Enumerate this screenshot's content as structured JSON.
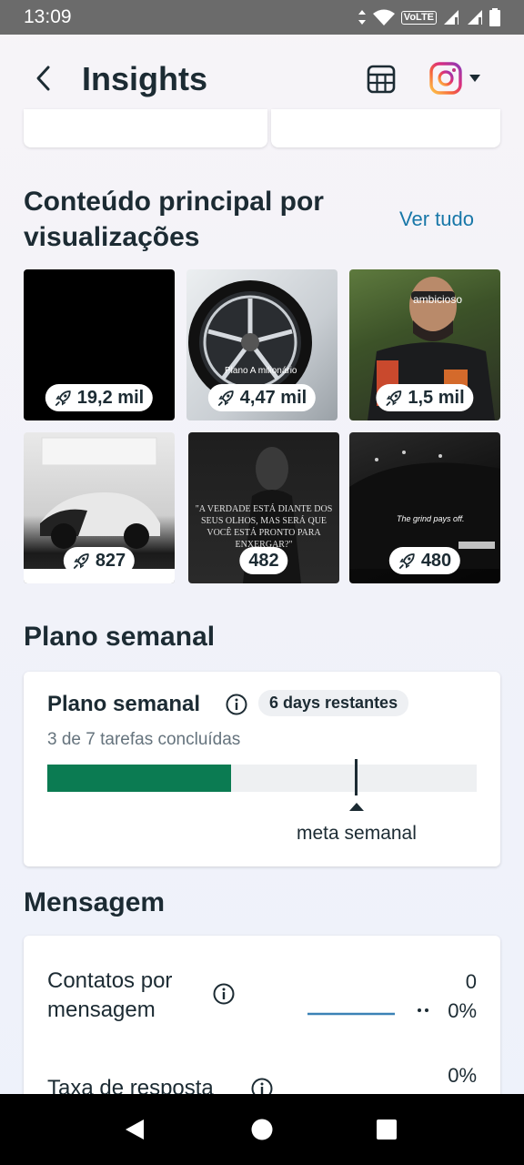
{
  "status_bar": {
    "time": "13:09",
    "volte": "VoLTE"
  },
  "header": {
    "title": "Insights",
    "icons": [
      "back-arrow-icon",
      "calendar-grid-icon",
      "instagram-icon",
      "caret-down-icon"
    ]
  },
  "top_content": {
    "title": "Conteúdo principal por visualizações",
    "title_line1": "Conteúdo principal por",
    "title_line2": "visualizações",
    "see_all": "Ver tudo",
    "items": [
      {
        "views": "19,2 mil",
        "has_icon": true,
        "caption": ""
      },
      {
        "views": "4,47 mil",
        "has_icon": true,
        "caption": "Plano A milionário"
      },
      {
        "views": "1,5 mil",
        "has_icon": true,
        "caption": "ambicioso"
      },
      {
        "views": "827",
        "has_icon": true,
        "caption": ""
      },
      {
        "views": "482",
        "has_icon": false,
        "caption": "\"A VERDADE ESTÁ DIANTE DOS SEUS OLHOS, MAS SERÁ QUE VOCÊ ESTÁ PRONTO PARA ENXERGAR?\""
      },
      {
        "views": "480",
        "has_icon": true,
        "caption": "The grind pays off."
      }
    ]
  },
  "weekly_plan": {
    "section_title": "Plano semanal",
    "card_title": "Plano semanal",
    "badge": "6 days restantes",
    "subtitle": "3 de 7 tarefas concluídas",
    "progress_fraction": 0.4286,
    "goal_fraction": 0.72,
    "goal_label": "meta semanal",
    "progress_color": "#0b7b52"
  },
  "messages": {
    "section_title": "Mensagem",
    "rows": [
      {
        "label_line1": "Contatos por",
        "label_line2": "mensagem",
        "value": "0",
        "change": "0%"
      },
      {
        "label_line1": "Taxa de resposta",
        "label_line2": "",
        "value": "0%",
        "change": ""
      }
    ]
  },
  "nav_bar": {
    "icons": [
      "nav-back-icon",
      "nav-home-icon",
      "nav-recents-icon"
    ]
  }
}
